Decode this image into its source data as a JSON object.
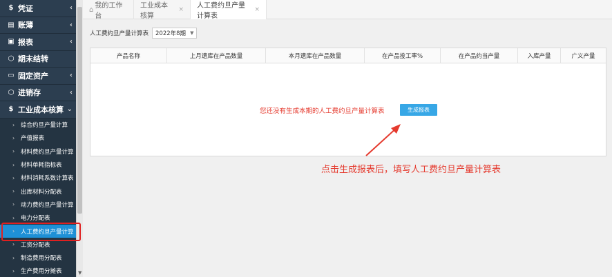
{
  "sidebar": {
    "menu": [
      {
        "icon": "$",
        "label": "凭证",
        "chevron": "‹"
      },
      {
        "icon": "▤",
        "label": "账薄",
        "chevron": "‹"
      },
      {
        "icon": "▣",
        "label": "报表",
        "chevron": "‹"
      },
      {
        "icon": "⬡",
        "label": "期末结转",
        "chevron": ""
      },
      {
        "icon": "▭",
        "label": "固定资产",
        "chevron": "‹"
      },
      {
        "icon": "⬡",
        "label": "进销存",
        "chevron": "‹"
      },
      {
        "icon": "$",
        "label": "工业成本核算",
        "chevron": "⌄"
      }
    ],
    "submenu": [
      "综合约旦产量计算",
      "产值报表",
      "材料费约旦产量计算",
      "材料单耗指标表",
      "材料消耗系数计算表",
      "出库材料分配表",
      "动力费约旦产量计算",
      "电力分配表",
      "人工费约旦产量计算",
      "工资分配表",
      "制造费用分配表",
      "生产费用分摊表"
    ],
    "active_index": 8,
    "accent": "#1e90d6"
  },
  "tabs": [
    {
      "label": "我的工作台",
      "closable": false,
      "home": true
    },
    {
      "label": "工业成本核算",
      "closable": true
    },
    {
      "label": "人工费约旦产量计算表",
      "closable": true,
      "active": true
    }
  ],
  "filter": {
    "label": "人工费约旦产量计算表",
    "period": "2022年8期"
  },
  "table": {
    "columns": [
      "产品名称",
      "上月遗库在产品数量",
      "本月遗库在产品数量",
      "在产品投工率%",
      "在产品约当产量",
      "入库产量",
      "广义产量"
    ]
  },
  "empty_message": "您还没有生成本期的人工费约旦产量计算表",
  "generate_button": "生成报表",
  "annotation": {
    "text": "点击生成报表后，填写人工费约旦产量计算表",
    "color": "#e53a2e"
  }
}
